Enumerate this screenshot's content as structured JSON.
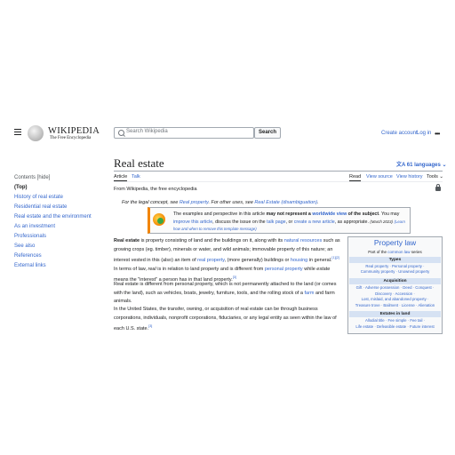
{
  "header": {
    "logo_title": "WIKIPEDIA",
    "logo_tagline": "The Free Encyclopedia",
    "search_placeholder": "Search Wikipedia",
    "search_button": "Search",
    "create_account": "Create account",
    "log_in": "Log in"
  },
  "toc": {
    "title": "Contents [hide]",
    "top": "(Top)",
    "items": [
      "History of real estate",
      "Residential real estate",
      "Real estate and the environment",
      "As an investment",
      "Professionals",
      "See also",
      "References",
      "External links"
    ]
  },
  "article": {
    "title": "Real estate",
    "languages": "61 languages",
    "tabs": {
      "article": "Article",
      "talk": "Talk",
      "read": "Read",
      "view_source": "View source",
      "view_history": "View history",
      "tools": "Tools"
    },
    "from": "From Wikipedia, the free encyclopedia",
    "hatnote": {
      "a": "For the legal concept, see ",
      "link1": "Real property",
      "b": ". For other uses, see ",
      "link2": "Real Estate (disambiguation)",
      "c": "."
    },
    "notice": {
      "a": "The examples and perspective in this article ",
      "bold": "may not represent a ",
      "link_bold": "worldwide view",
      "bold2": " of the subject",
      "b": ". You may ",
      "link1": "improve this article",
      "c": ", discuss the issue on the ",
      "link2": "talk page",
      "d": ", or ",
      "link3": "create a new article",
      "e": ", as appropriate. ",
      "date": "(March 2023)",
      "small": "(Learn how and when to remove this template message)"
    },
    "para1": {
      "bold": "Real estate",
      "a": " is property consisting of land and the buildings on it, along with its ",
      "l1": "natural resources",
      "b": " such as growing crops (eg. timber), minerals or water, and wild animals; immovable property of this nature; an interest vested in this (also) an item of ",
      "l2": "real property",
      "c": ", (more generally) buildings or ",
      "l3": "housing",
      "d": " in general.",
      "sup1": "[1][2]",
      "e": " In terms of law, ",
      "i1": "real",
      "f": " is in relation to land property and is different from ",
      "l4": "personal property",
      "g": " while ",
      "i2": "estate",
      "h": " means the \"interest\" a person has in that land property.",
      "sup2": "[3]"
    },
    "para2": {
      "a": "Real estate is different from personal property, which is not permanently attached to the land (or comes with the land), such as vehicles, boats, jewelry, furniture, tools, and the rolling stock of a ",
      "l1": "farm",
      "b": " and farm animals."
    },
    "para3": {
      "a": "In the United States, the transfer, owning, or acquisition of real estate can be through business corporations, individuals, nonprofit corporations, fiduciaries, or any legal entity as seen within the law of each U.S. state.",
      "sup": "[3]"
    }
  },
  "infobox": {
    "title": "Property law",
    "part_a": "Part of the ",
    "part_link": "common law",
    "part_b": " series",
    "sections": [
      {
        "heading": "Types",
        "rows": [
          "Real property · Personal property ·",
          "Community property · Unowned property"
        ]
      },
      {
        "heading": "Acquisition",
        "rows": [
          "Gift · Adverse possession · Deed · Conquest ·",
          "Discovery · Accession ·",
          "Lost, mislaid, and abandoned property ·",
          "Treasure trove · Bailment · License · Alienation"
        ]
      },
      {
        "heading": "Estates in land",
        "rows": [
          "Allodial title · Fee simple · Fee tail ·",
          "Life estate · Defeasible estate · Future interest"
        ]
      }
    ]
  },
  "icons": {
    "menu": "hamburger-icon",
    "search": "search-icon",
    "more": "ellipsis-icon",
    "lang": "translate-icon",
    "lock": "lock-icon",
    "notice": "globe-notice-icon"
  }
}
